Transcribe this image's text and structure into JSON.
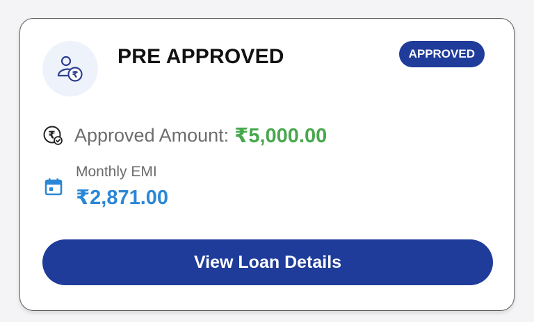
{
  "card": {
    "title": "PRE APPROVED",
    "status_badge": "APPROVED",
    "avatar_icon": "user-rupee-icon",
    "approved_amount": {
      "icon": "rupee-coin-check-icon",
      "label": "Approved Amount:",
      "value": "₹5,000.00",
      "color": "#47a84d"
    },
    "monthly_emi": {
      "icon": "calendar-icon",
      "label": "Monthly EMI",
      "value": "₹2,871.00",
      "color": "#2a87d6"
    },
    "button_label": "View Loan Details",
    "accent_color": "#1f3c9b"
  }
}
